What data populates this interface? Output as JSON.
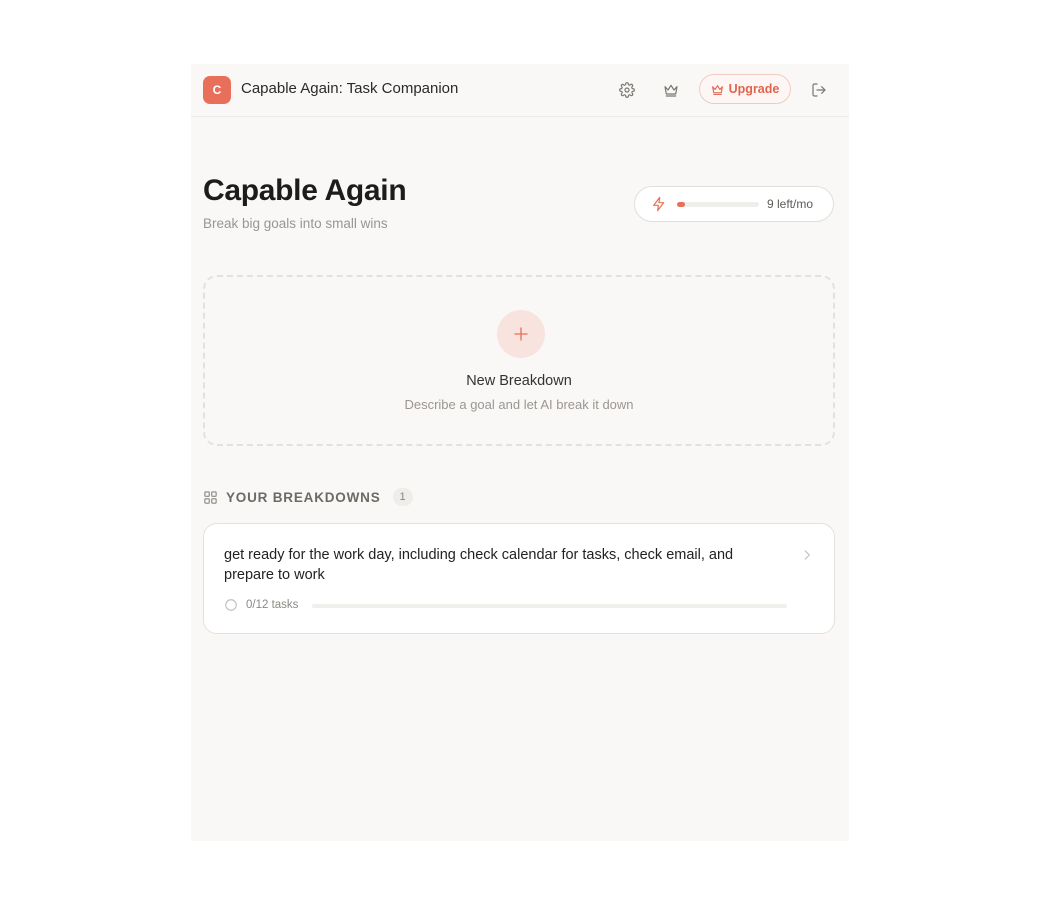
{
  "header": {
    "logo_letter": "C",
    "app_title": "Capable Again: Task Companion",
    "upgrade_label": "Upgrade"
  },
  "page": {
    "title": "Capable Again",
    "subtitle": "Break big goals into small wins"
  },
  "quota": {
    "label": "9 left/mo",
    "used_fraction": 0.1
  },
  "new_breakdown": {
    "title": "New Breakdown",
    "description": "Describe a goal and let AI break it down"
  },
  "breakdowns": {
    "section_label": "YOUR BREAKDOWNS",
    "count": "1",
    "items": [
      {
        "title": "get ready for the work day, including check calendar for tasks, check email, and prepare to work",
        "progress_label": "0/12 tasks",
        "completed": 0,
        "total": 12
      }
    ]
  },
  "colors": {
    "accent": "#e8705a",
    "background": "#f9f8f6",
    "muted_text": "#9a9590"
  },
  "icons": [
    "gear-icon",
    "crown-icon",
    "logout-icon",
    "bolt-icon",
    "plus-icon",
    "grid-icon",
    "chevron-right-icon",
    "circle-status-icon"
  ]
}
